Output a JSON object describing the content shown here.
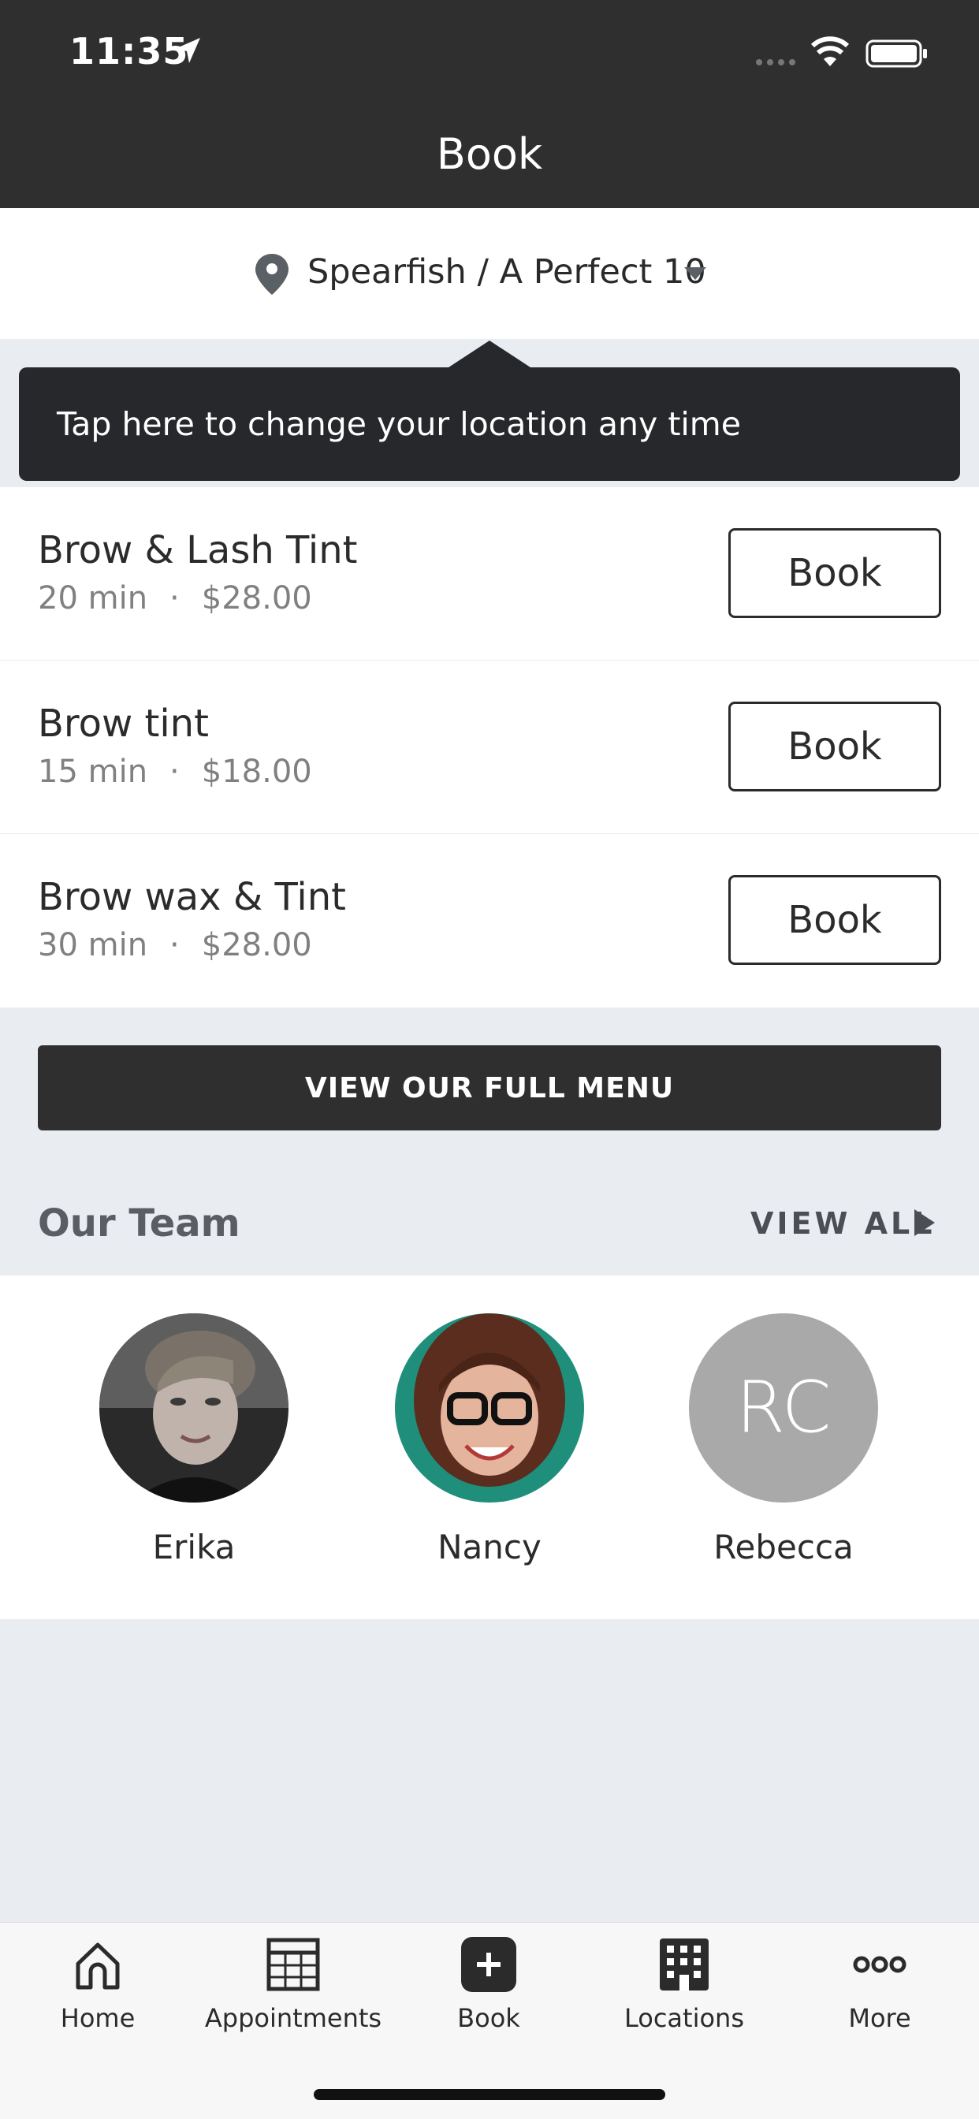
{
  "status_bar": {
    "time": "11:35"
  },
  "nav": {
    "title": "Book"
  },
  "location": {
    "label": "Spearfish / A Perfect 10"
  },
  "tooltip": {
    "text": "Tap here to change your location any time"
  },
  "services": [
    {
      "name": "Brow & Lash Tint",
      "duration": "20 min",
      "separator": "·",
      "price": "$28.00",
      "button": "Book"
    },
    {
      "name": "Brow tint",
      "duration": "15 min",
      "separator": "·",
      "price": "$18.00",
      "button": "Book"
    },
    {
      "name": "Brow wax & Tint",
      "duration": "30 min",
      "separator": "·",
      "price": "$28.00",
      "button": "Book"
    }
  ],
  "menu_button": "VIEW OUR FULL MENU",
  "team": {
    "title": "Our Team",
    "view_all": "VIEW ALL",
    "members": [
      {
        "name": "Erika"
      },
      {
        "name": "Nancy"
      },
      {
        "name": "Rebecca",
        "initials": "RC"
      }
    ]
  },
  "tabs": [
    {
      "label": "Home",
      "icon": "home-icon"
    },
    {
      "label": "Appointments",
      "icon": "calendar-grid-icon"
    },
    {
      "label": "Book",
      "icon": "plus-square-icon"
    },
    {
      "label": "Locations",
      "icon": "building-icon"
    },
    {
      "label": "More",
      "icon": "more-dots-icon"
    }
  ],
  "colors": {
    "header": "#2f2f2f",
    "background": "#e9ecf1",
    "initials_avatar": "#a9a9a9"
  }
}
